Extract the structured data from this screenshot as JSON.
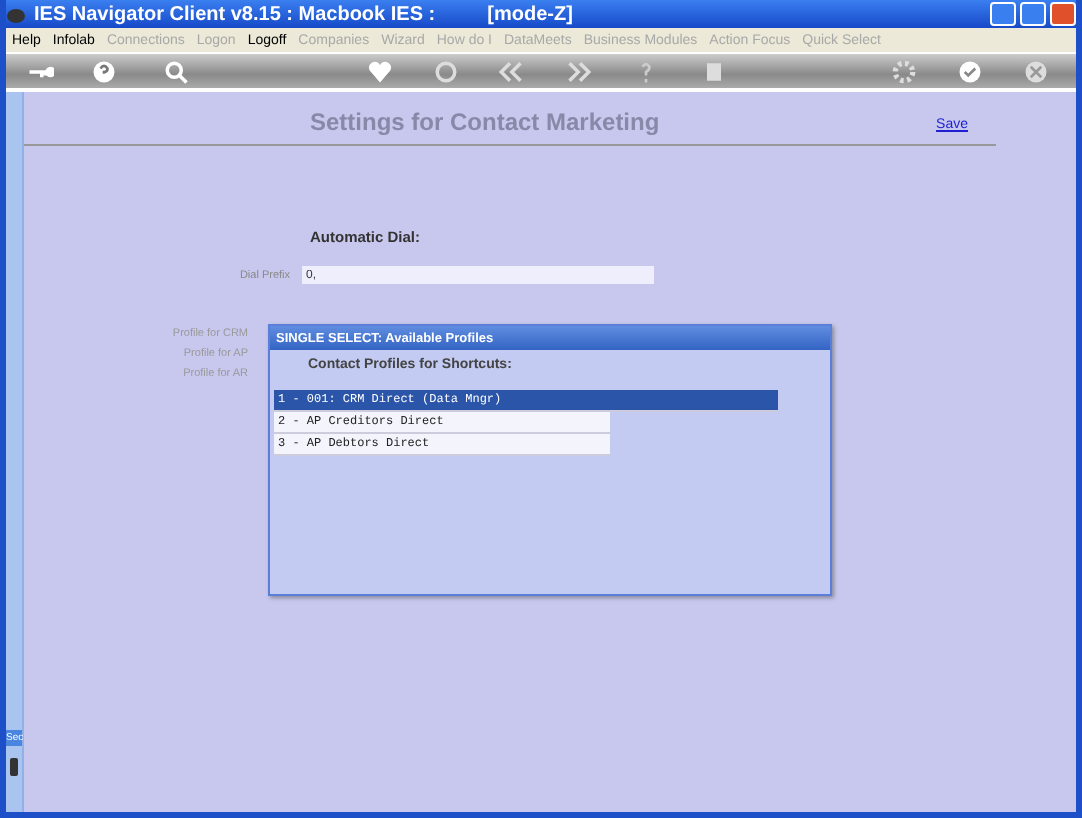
{
  "window": {
    "title": "IES Navigator Client v8.15 : Macbook IES :",
    "mode": "[mode-Z]"
  },
  "menu": [
    {
      "label": "Help",
      "disabled": false
    },
    {
      "label": "Infolab",
      "disabled": false
    },
    {
      "label": "Connections",
      "disabled": true
    },
    {
      "label": "Logon",
      "disabled": true
    },
    {
      "label": "Logoff",
      "disabled": false
    },
    {
      "label": "Companies",
      "disabled": true
    },
    {
      "label": "Wizard",
      "disabled": true
    },
    {
      "label": "How do I",
      "disabled": true
    },
    {
      "label": "DataMeets",
      "disabled": true
    },
    {
      "label": "Business Modules",
      "disabled": true
    },
    {
      "label": "Action Focus",
      "disabled": true
    },
    {
      "label": "Quick Select",
      "disabled": true
    }
  ],
  "page": {
    "heading": "Settings for Contact Marketing",
    "save": "Save",
    "section": "Automatic Dial:",
    "fields": [
      {
        "label": "Dial Prefix",
        "value": "0,"
      }
    ],
    "hidden_labels": [
      "Profile for CRM",
      "Profile for AP",
      "Profile for AR"
    ]
  },
  "dialog": {
    "title": "SINGLE SELECT: Available Profiles",
    "heading": "Contact Profiles for Shortcuts:",
    "items": [
      {
        "label": "1 - 001: CRM Direct (Data Mngr)",
        "selected": true
      },
      {
        "label": "2 - AP Creditors Direct",
        "selected": false
      },
      {
        "label": "3 - AP Debtors Direct",
        "selected": false
      }
    ]
  },
  "side": {
    "badge": "Sec"
  }
}
